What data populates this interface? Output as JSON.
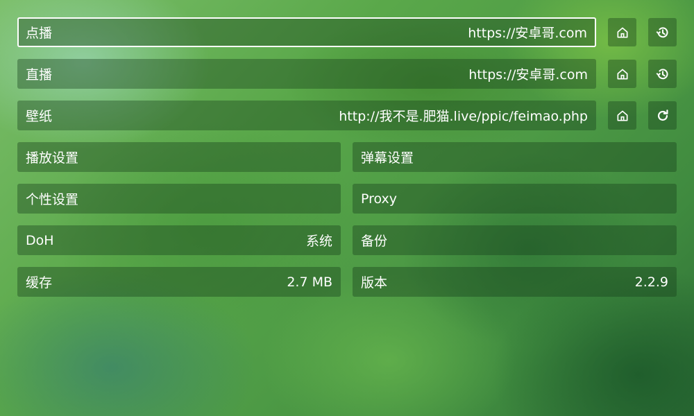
{
  "sources": [
    {
      "label": "点播",
      "value": "https://安卓哥.com",
      "buttons": [
        "home-icon",
        "history-icon"
      ]
    },
    {
      "label": "直播",
      "value": "https://安卓哥.com",
      "buttons": [
        "home-icon",
        "history-icon"
      ]
    },
    {
      "label": "壁纸",
      "value": "http://我不是.肥猫.live/ppic/feimao.php",
      "buttons": [
        "home-icon",
        "refresh-icon"
      ]
    }
  ],
  "settings": {
    "playback": {
      "label": "播放设置"
    },
    "danmaku": {
      "label": "弹幕设置"
    },
    "personal": {
      "label": "个性设置"
    },
    "proxy": {
      "label": "Proxy"
    },
    "doh": {
      "label": "DoH",
      "value": "系统"
    },
    "backup": {
      "label": "备份"
    },
    "cache": {
      "label": "缓存",
      "value": "2.7 MB"
    },
    "version": {
      "label": "版本",
      "value": "2.2.9"
    }
  },
  "colors": {
    "text": "#ffffff",
    "row_background": "rgba(20,60,25,0.38)",
    "focus_border": "#ffffff"
  }
}
